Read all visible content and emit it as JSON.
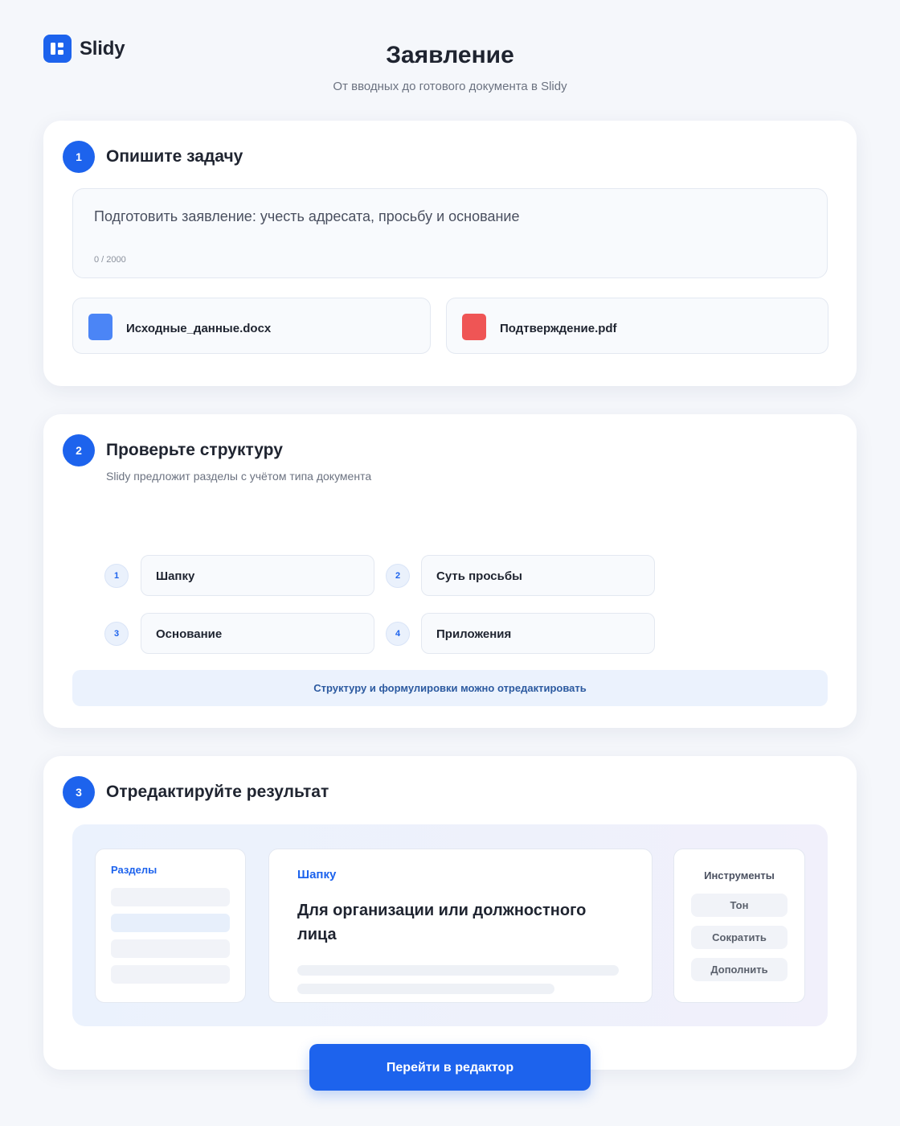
{
  "brand": {
    "name": "Slidy",
    "icon": "slidy-logo-icon",
    "accent": "#1d63ed"
  },
  "header": {
    "title": "Заявление",
    "subtitle": "От вводных до готового документа в Slidy"
  },
  "step1": {
    "number": "1",
    "title": "Опишите задачу",
    "input": {
      "value": "Подготовить заявление: учесть адресата, просьбу и основание",
      "counter": "0 / 2000"
    },
    "files": [
      {
        "name": "Исходные_данные.docx",
        "icon": "docx-file-icon",
        "color": "#4b85f6"
      },
      {
        "name": "Подтверждение.pdf",
        "icon": "pdf-file-icon",
        "color": "#ef5555"
      }
    ]
  },
  "step2": {
    "number": "2",
    "title": "Проверьте структуру",
    "description": "Slidy предложит разделы с учётом типа документа",
    "sections": [
      {
        "num": "1",
        "label": "Шапку"
      },
      {
        "num": "2",
        "label": "Суть просьбы"
      },
      {
        "num": "3",
        "label": "Основание"
      },
      {
        "num": "4",
        "label": "Приложения"
      }
    ],
    "note": "Структуру и формулировки можно отредактировать"
  },
  "step3": {
    "number": "3",
    "title": "Отредактируйте результат",
    "preview": {
      "sections_label": "Разделы",
      "section_name": "Шапку",
      "heading": "Для организации или должностного лица",
      "tools_label": "Инструменты",
      "tools": [
        "Тон",
        "Сократить",
        "Дополнить"
      ]
    }
  },
  "cta": {
    "label": "Перейти в редактор"
  }
}
